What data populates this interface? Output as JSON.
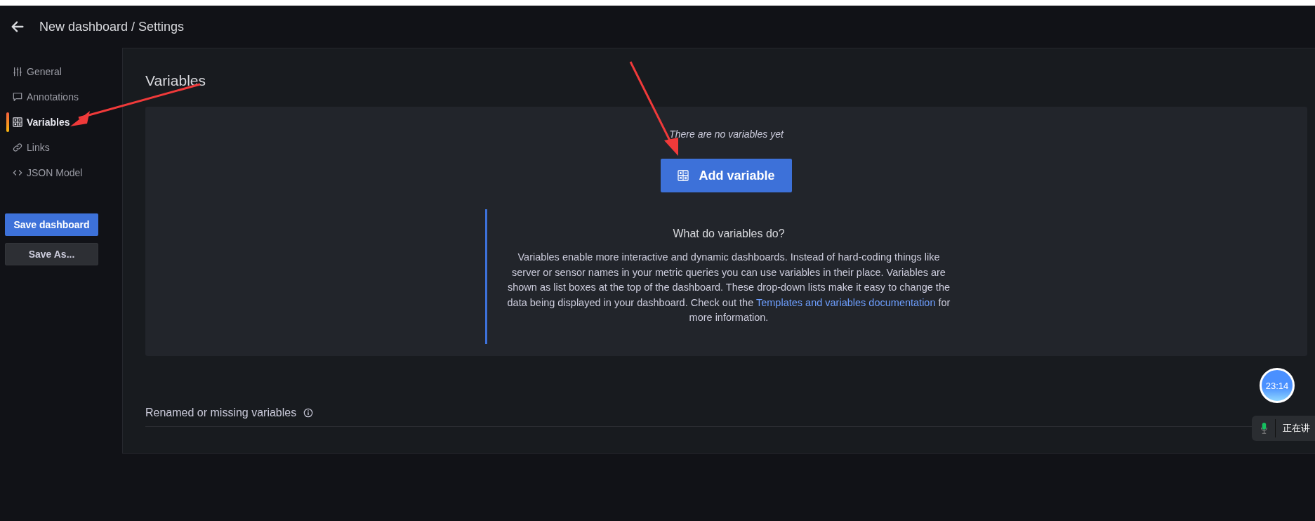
{
  "header": {
    "title": "New dashboard / Settings"
  },
  "sidebar": {
    "items": [
      {
        "label": "General",
        "selected": false
      },
      {
        "label": "Annotations",
        "selected": false
      },
      {
        "label": "Variables",
        "selected": true
      },
      {
        "label": "Links",
        "selected": false
      },
      {
        "label": "JSON Model",
        "selected": false
      }
    ],
    "buttons": [
      {
        "label": "Save dashboard",
        "kind": "primary"
      },
      {
        "label": "Save As...",
        "kind": "secondary"
      }
    ]
  },
  "main": {
    "title": "Variables",
    "empty_message": "There are no variables yet",
    "add_button": "Add variable",
    "info": {
      "title": "What do variables do?",
      "text": "Variables enable more interactive and dynamic dashboards. Instead of hard-coding things like server or sensor names in your metric queries you can use variables in their place. Variables are shown as list boxes at the top of the dashboard. These drop-down lists make it easy to change the data being displayed in your dashboard. Check out the",
      "link": "Templates and variables documentation",
      "text_after": "for more information."
    },
    "renamed_section": "Renamed or missing variables"
  },
  "overlay": {
    "clock": "23:14",
    "speech_status": "正在讲"
  }
}
